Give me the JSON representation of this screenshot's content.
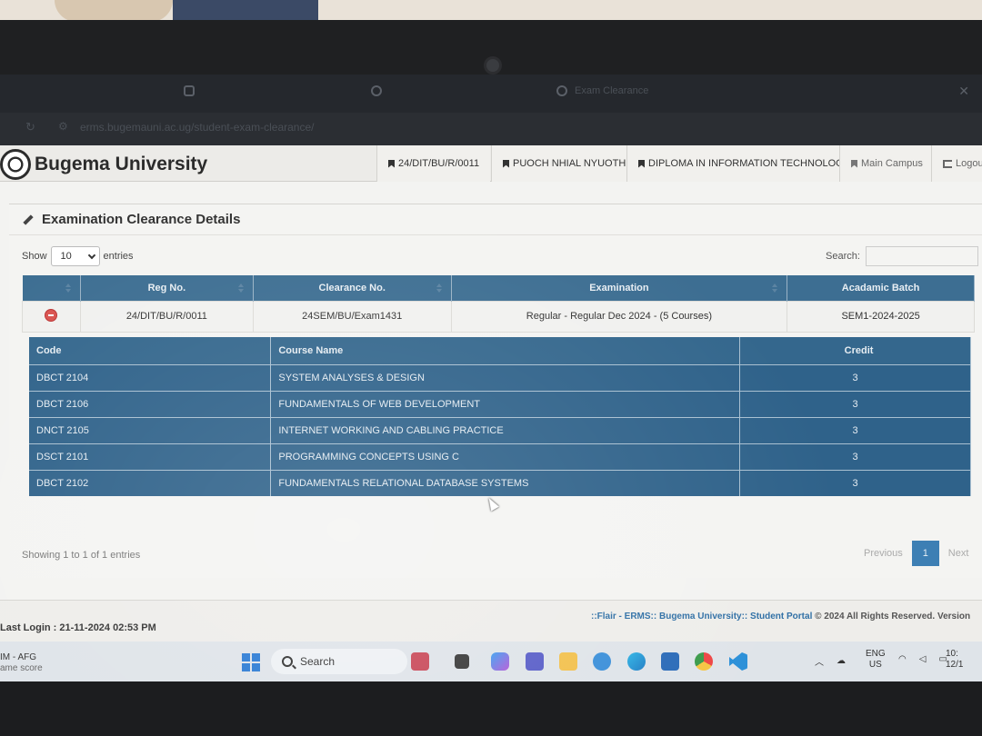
{
  "browser": {
    "tabs": [
      {
        "label": "",
        "icon": "rounded-square-icon"
      },
      {
        "label": "",
        "icon": "whatsapp-icon"
      },
      {
        "label": "Exam Clearance",
        "icon": "site-icon"
      }
    ],
    "url": "erms.bugemauni.ac.ug/student-exam-clearance/"
  },
  "header": {
    "brand": "Bugema University",
    "nav": [
      {
        "label": "24/DIT/BU/R/0011",
        "icon": "bookmark-icon"
      },
      {
        "label": "PUOCH NHIAL NYUOTH",
        "icon": "bookmark-icon"
      },
      {
        "label": "DIPLOMA IN INFORMATION TECHNOLOGY",
        "icon": "bookmark-icon"
      },
      {
        "label": "Main Campus",
        "icon": "bookmark-icon"
      },
      {
        "label": "Logout",
        "icon": "logout-icon"
      }
    ]
  },
  "panel": {
    "title": "Examination Clearance Details",
    "show_label": "Show",
    "entries_value": "10",
    "entries_label": "entries",
    "search_label": "Search:",
    "search_value": ""
  },
  "main_table": {
    "columns": [
      "",
      "Reg No.",
      "Clearance No.",
      "Examination",
      "Acadamic Batch"
    ],
    "row": {
      "reg_no": "24/DIT/BU/R/0011",
      "clearance_no": "24SEM/BU/Exam1431",
      "examination": "Regular - Regular Dec 2024 - (5 Courses)",
      "batch": "SEM1-2024-2025"
    }
  },
  "courses": {
    "columns": [
      "Code",
      "Course Name",
      "Credit"
    ],
    "rows": [
      {
        "code": "DBCT 2104",
        "name": "SYSTEM ANALYSES & DESIGN",
        "credit": "3"
      },
      {
        "code": "DBCT 2106",
        "name": "FUNDAMENTALS OF WEB DEVELOPMENT",
        "credit": "3"
      },
      {
        "code": "DNCT 2105",
        "name": "INTERNET WORKING AND CABLING PRACTICE",
        "credit": "3"
      },
      {
        "code": "DSCT 2101",
        "name": "PROGRAMMING CONCEPTS USING C",
        "credit": "3"
      },
      {
        "code": "DBCT 2102",
        "name": "FUNDAMENTALS RELATIONAL DATABASE SYSTEMS",
        "credit": "3"
      }
    ]
  },
  "pagination": {
    "info": "Showing 1 to 1 of 1 entries",
    "previous": "Previous",
    "current": "1",
    "next": "Next"
  },
  "footer": {
    "last_login": "Last Login : 21-11-2024 02:53 PM",
    "copyright_accent": "::Flair - ERMS:: Bugema University:: Student Portal",
    "copyright_rest": " © 2024 All Rights Reserved. Version"
  },
  "taskbar": {
    "weather_line1": "IM - AFG",
    "weather_line2": "ame score",
    "search": "Search",
    "lang_line1": "ENG",
    "lang_line2": "US",
    "clock_line1": "10:",
    "clock_line2": "12/1"
  }
}
